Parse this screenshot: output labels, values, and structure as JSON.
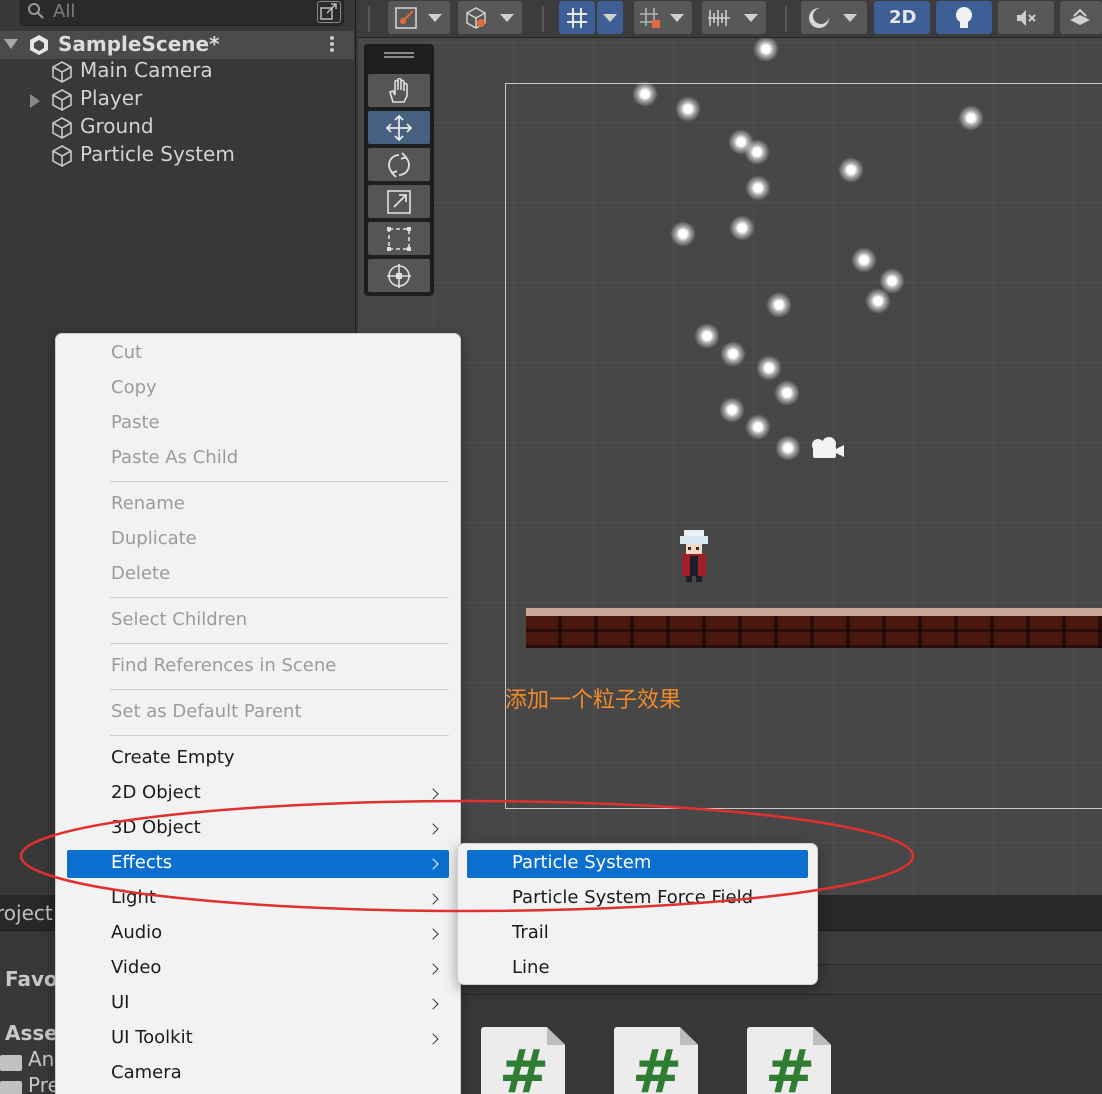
{
  "hierarchy": {
    "search_placeholder": "All",
    "scene_title": "SampleScene*",
    "items": [
      {
        "label": "Main Camera",
        "expandable": false
      },
      {
        "label": "Player",
        "expandable": true
      },
      {
        "label": "Ground",
        "expandable": false
      },
      {
        "label": "Particle System",
        "expandable": false
      }
    ]
  },
  "scene_toolbar": {
    "toggle_2d_label": "2D"
  },
  "scene": {
    "annotation": "添加一个粒子效果",
    "annotation_color": "#f18a2a"
  },
  "project_panel": {
    "tab_label": "roject",
    "favorites_label": "Favo",
    "assets_label": "Asse",
    "folders": [
      "An",
      "Pre"
    ]
  },
  "context_menu": {
    "items": [
      {
        "label": "Cut",
        "disabled": true
      },
      {
        "label": "Copy",
        "disabled": true
      },
      {
        "label": "Paste",
        "disabled": true
      },
      {
        "label": "Paste As Child",
        "disabled": true
      },
      {
        "label": "Rename",
        "disabled": true
      },
      {
        "label": "Duplicate",
        "disabled": true
      },
      {
        "label": "Delete",
        "disabled": true
      },
      {
        "label": "Select Children",
        "disabled": true
      },
      {
        "label": "Find References in Scene",
        "disabled": true
      },
      {
        "label": "Set as Default Parent",
        "disabled": true
      },
      {
        "label": "Create Empty",
        "disabled": false
      },
      {
        "label": "2D Object",
        "disabled": false,
        "submenu": true
      },
      {
        "label": "3D Object",
        "disabled": false,
        "submenu": true
      },
      {
        "label": "Effects",
        "disabled": false,
        "submenu": true,
        "selected": true
      },
      {
        "label": "Light",
        "disabled": false,
        "submenu": true
      },
      {
        "label": "Audio",
        "disabled": false,
        "submenu": true
      },
      {
        "label": "Video",
        "disabled": false,
        "submenu": true
      },
      {
        "label": "UI",
        "disabled": false,
        "submenu": true
      },
      {
        "label": "UI Toolkit",
        "disabled": false,
        "submenu": true
      },
      {
        "label": "Camera",
        "disabled": false
      }
    ]
  },
  "effects_submenu": {
    "items": [
      {
        "label": "Particle System",
        "selected": true
      },
      {
        "label": "Particle System Force Field"
      },
      {
        "label": "Trail"
      },
      {
        "label": "Line"
      }
    ]
  },
  "colors": {
    "menu_highlight": "#0b6fd0",
    "annotation_ellipse": "#e03030",
    "active_tool": "#46607f",
    "toggle_on": "#3e5f96"
  }
}
